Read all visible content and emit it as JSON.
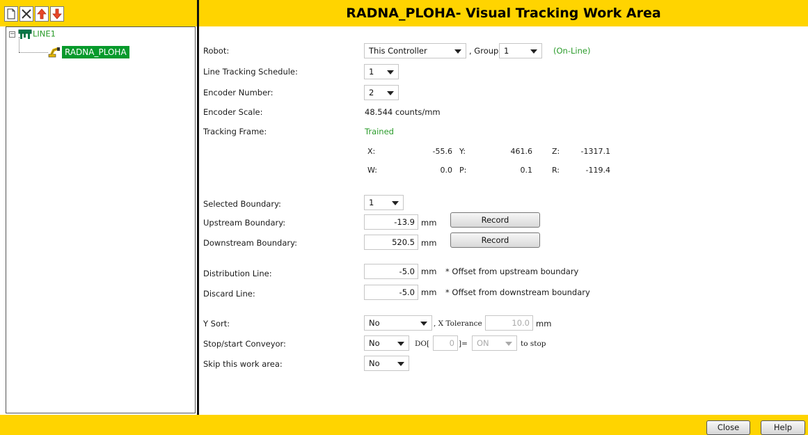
{
  "toolbar": {
    "icons": [
      "new-icon",
      "delete-icon",
      "move-up-icon",
      "move-down-icon"
    ]
  },
  "tree": {
    "root": {
      "label": "LINE1",
      "icon": "conveyor-line-icon"
    },
    "child": {
      "label": "RADNA_PLOHA",
      "icon": "robot-icon"
    }
  },
  "header": {
    "title": "RADNA_PLOHA- Visual Tracking Work Area"
  },
  "form": {
    "robot": {
      "label": "Robot:",
      "controller": "This Controller",
      "group_prefix": ", Group",
      "group": "1",
      "status": "(On-Line)"
    },
    "schedule": {
      "label": "Line Tracking Schedule:",
      "value": "1"
    },
    "encoder_number": {
      "label": "Encoder Number:",
      "value": "2"
    },
    "encoder_scale": {
      "label": "Encoder Scale:",
      "value": "48.544 counts/mm"
    },
    "tracking_frame": {
      "label": "Tracking Frame:",
      "status": "Trained",
      "coords": [
        {
          "name": "X:",
          "value": "-55.6"
        },
        {
          "name": "Y:",
          "value": "461.6"
        },
        {
          "name": "Z:",
          "value": "-1317.1"
        },
        {
          "name": "W:",
          "value": "0.0"
        },
        {
          "name": "P:",
          "value": "0.1"
        },
        {
          "name": "R:",
          "value": "-119.4"
        }
      ]
    },
    "selected_boundary": {
      "label": "Selected Boundary:",
      "value": "1"
    },
    "upstream": {
      "label": "Upstream Boundary:",
      "value": "-13.9",
      "unit": "mm",
      "button": "Record"
    },
    "downstream": {
      "label": "Downstream Boundary:",
      "value": "520.5",
      "unit": "mm",
      "button": "Record"
    },
    "distribution": {
      "label": "Distribution Line:",
      "value": "-5.0",
      "unit": "mm",
      "note": "* Offset from upstream boundary"
    },
    "discard": {
      "label": "Discard Line:",
      "value": "-5.0",
      "unit": "mm",
      "note": "* Offset from downstream boundary"
    },
    "y_sort": {
      "label": "Y Sort:",
      "value": "No",
      "tol_label": ", X Tolerance",
      "tol_value": "10.0",
      "tol_unit": "mm"
    },
    "conveyor": {
      "label": "Stop/start Conveyor:",
      "value": "No",
      "do_label": "DO[",
      "do_index": "0",
      "do_close": "]=",
      "do_state": "ON",
      "suffix": "to stop"
    },
    "skip": {
      "label": "Skip this work area:",
      "value": "No"
    }
  },
  "footer": {
    "close": "Close",
    "help": "Help"
  },
  "colors": {
    "accent": "#ffd400",
    "selected": "#079a2c",
    "online": "#2a9b2a"
  }
}
